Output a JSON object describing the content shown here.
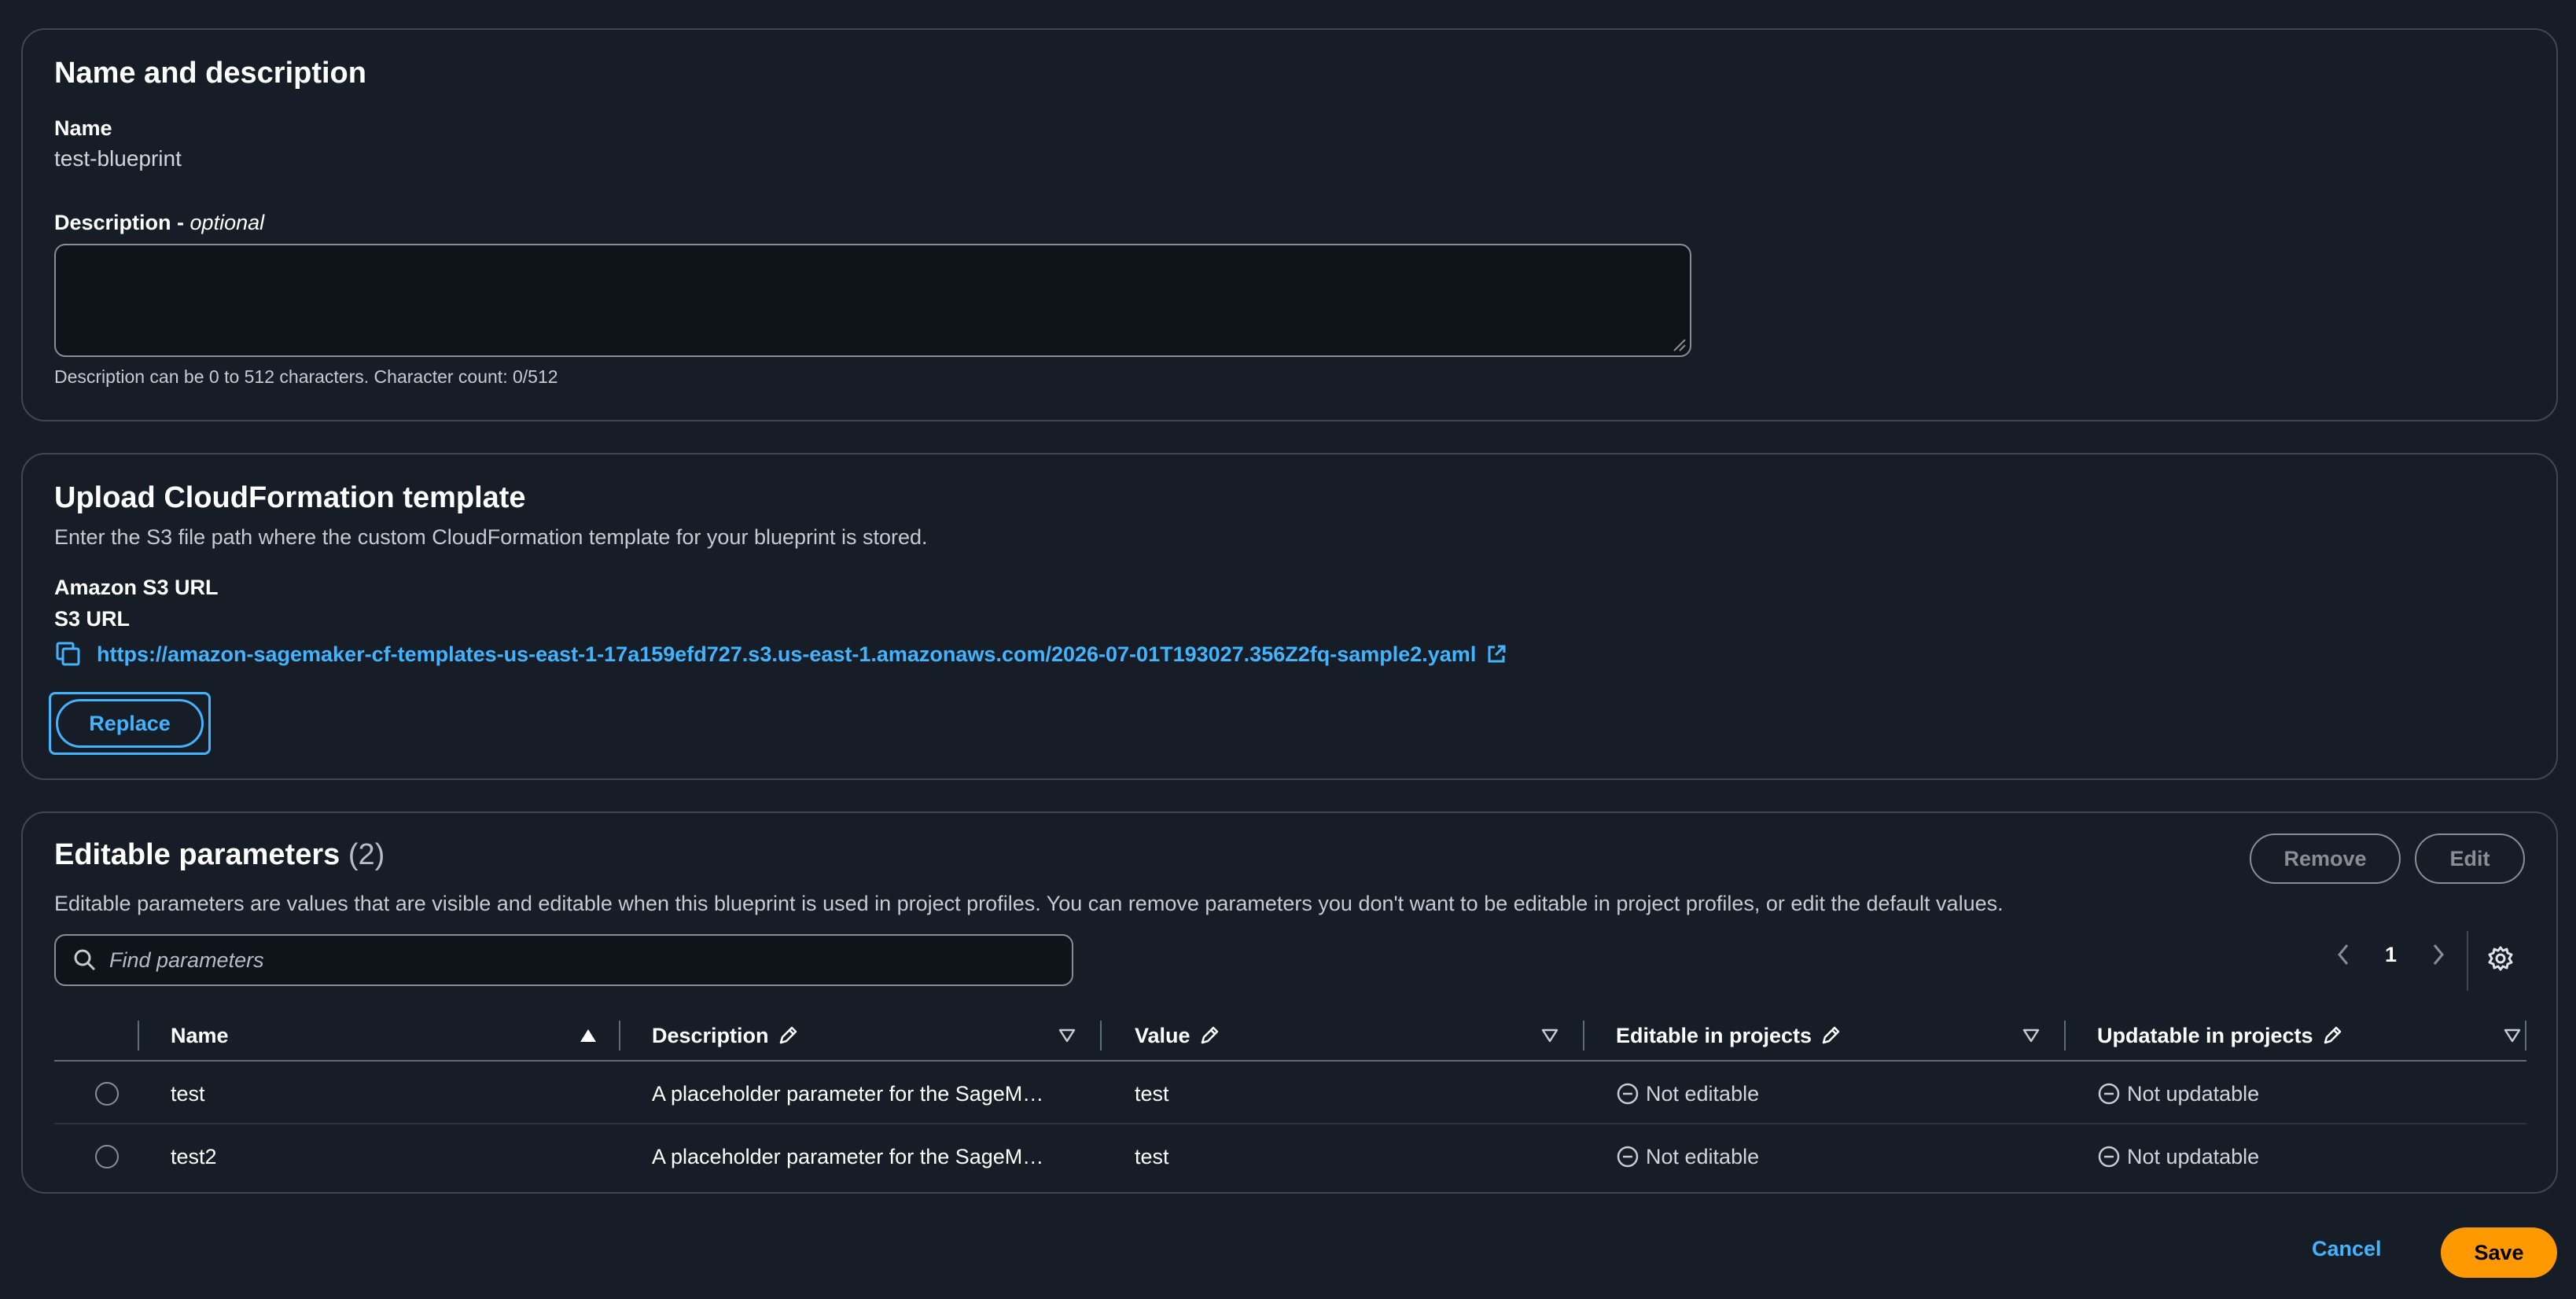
{
  "name_section": {
    "title": "Name and description",
    "name_label": "Name",
    "name_value": "test-blueprint",
    "description_label": "Description - ",
    "description_optional": "optional",
    "description_value": "",
    "description_hint": "Description can be 0 to 512 characters. Character count: 0/512"
  },
  "upload_section": {
    "title": "Upload CloudFormation template",
    "subtitle": "Enter the S3 file path where the custom CloudFormation template for your blueprint is stored.",
    "s3_label": "Amazon S3 URL",
    "s3_sublabel": "S3 URL",
    "s3_url": "https://amazon-sagemaker-cf-templates-us-east-1-17a159efd727.s3.us-east-1.amazonaws.com/2026-07-01T193027.356Z2fq-sample2.yaml",
    "replace_label": "Replace"
  },
  "params_section": {
    "title": "Editable parameters",
    "count": "(2)",
    "subtitle": "Editable parameters are values that are visible and editable when this blueprint is used in project profiles. You can remove parameters you don't want to be editable in project profiles, or edit the default values.",
    "remove_label": "Remove",
    "edit_label": "Edit",
    "search_placeholder": "Find parameters",
    "page_number": "1",
    "columns": {
      "name": "Name",
      "description": "Description",
      "value": "Value",
      "editable": "Editable in projects",
      "updatable": "Updatable in projects"
    },
    "rows": [
      {
        "name": "test",
        "description": "A placeholder parameter for the SageM…",
        "value": "test",
        "editable": "Not editable",
        "updatable": "Not updatable"
      },
      {
        "name": "test2",
        "description": "A placeholder parameter for the SageM…",
        "value": "test",
        "editable": "Not editable",
        "updatable": "Not updatable"
      }
    ]
  },
  "footer": {
    "cancel_label": "Cancel",
    "save_label": "Save"
  },
  "colors": {
    "background": "#161d26",
    "link": "#42b4ff",
    "primary_button": "#ff9900",
    "border": "#3f4753"
  }
}
